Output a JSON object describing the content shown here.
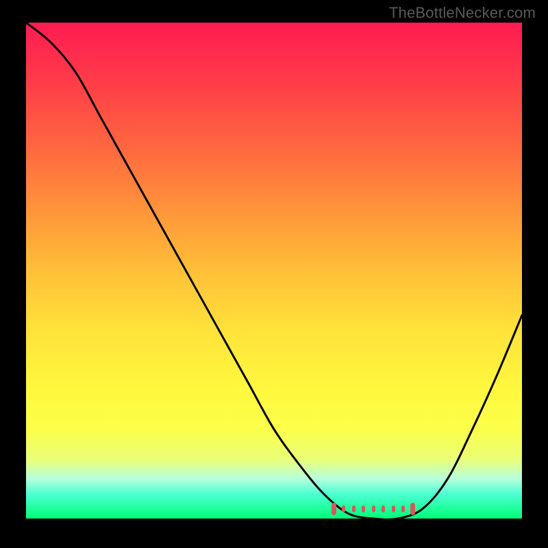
{
  "watermark": "TheBottleNecker.com",
  "colors": {
    "background": "#000000",
    "curve": "#000000",
    "marker": "#d45a59",
    "watermark": "#595959"
  },
  "chart_data": {
    "type": "line",
    "title": "",
    "xlabel": "",
    "ylabel": "",
    "xlim": [
      0,
      100
    ],
    "ylim": [
      0,
      100
    ],
    "x": [
      0,
      5,
      10,
      15,
      20,
      25,
      30,
      35,
      40,
      45,
      50,
      55,
      60,
      65,
      70,
      75,
      80,
      85,
      90,
      95,
      100
    ],
    "values": [
      100,
      96,
      90,
      81,
      72,
      63,
      54,
      45,
      36,
      27,
      18,
      11,
      5,
      1,
      0,
      0,
      2,
      8,
      18,
      29,
      41
    ],
    "optimal_range_x": [
      62,
      78
    ],
    "marker_y": 2
  }
}
